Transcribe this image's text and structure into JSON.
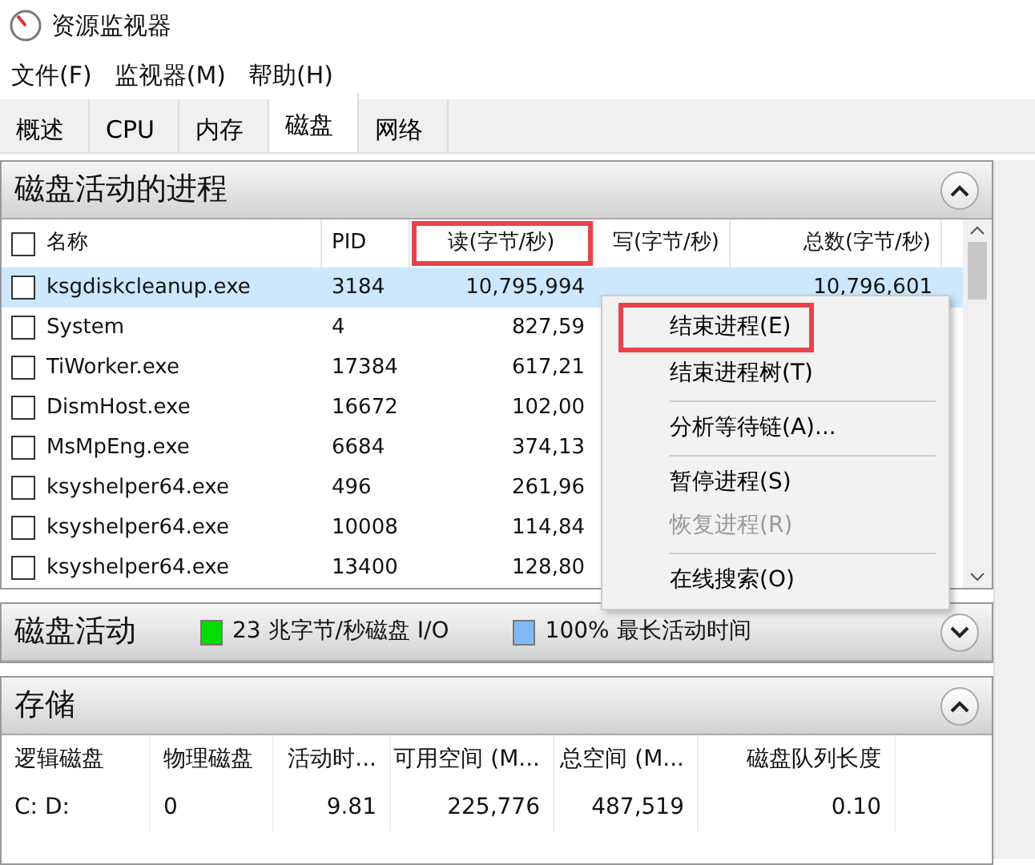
{
  "window": {
    "title": "资源监视器"
  },
  "menu": [
    "文件(F)",
    "监视器(M)",
    "帮助(H)"
  ],
  "tabs": [
    {
      "label": "概述",
      "selected": false
    },
    {
      "label": "CPU",
      "selected": false
    },
    {
      "label": "内存",
      "selected": false
    },
    {
      "label": "磁盘",
      "selected": true
    },
    {
      "label": "网络",
      "selected": false
    }
  ],
  "processes": {
    "title": "磁盘活动的进程",
    "expanded": true,
    "columns": [
      {
        "label": "名称",
        "highlighted": false
      },
      {
        "label": "PID",
        "highlighted": false
      },
      {
        "label": "读(字节/秒)",
        "highlighted": true
      },
      {
        "label": "写(字节/秒)",
        "highlighted": false
      },
      {
        "label": "总数(字节/秒)",
        "highlighted": false
      }
    ],
    "rows": [
      {
        "checked": false,
        "selected": true,
        "cells": [
          "ksgdiskcleanup.exe",
          "3184",
          "10,795,994",
          "",
          "10,796,601"
        ]
      },
      {
        "checked": false,
        "selected": false,
        "cells": [
          "System",
          "4",
          "827,59",
          "",
          ""
        ]
      },
      {
        "checked": false,
        "selected": false,
        "cells": [
          "TiWorker.exe",
          "17384",
          "617,21",
          "",
          ""
        ]
      },
      {
        "checked": false,
        "selected": false,
        "cells": [
          "DismHost.exe",
          "16672",
          "102,00",
          "",
          ""
        ]
      },
      {
        "checked": false,
        "selected": false,
        "cells": [
          "MsMpEng.exe",
          "6684",
          "374,13",
          "",
          ""
        ]
      },
      {
        "checked": false,
        "selected": false,
        "cells": [
          "ksyshelper64.exe",
          "496",
          "261,96",
          "",
          ""
        ]
      },
      {
        "checked": false,
        "selected": false,
        "cells": [
          "ksyshelper64.exe",
          "10008",
          "114,84",
          "",
          ""
        ]
      },
      {
        "checked": false,
        "selected": false,
        "cells": [
          "ksyshelper64.exe",
          "13400",
          "128,80",
          "",
          ""
        ]
      }
    ]
  },
  "context_menu": [
    {
      "label": "结束进程(E)",
      "disabled": false,
      "highlighted": true,
      "separator_before": false
    },
    {
      "label": "结束进程树(T)",
      "disabled": false,
      "highlighted": false,
      "separator_before": false
    },
    {
      "label": "分析等待链(A)...",
      "disabled": false,
      "highlighted": false,
      "separator_before": true
    },
    {
      "label": "暂停进程(S)",
      "disabled": false,
      "highlighted": false,
      "separator_before": true
    },
    {
      "label": "恢复进程(R)",
      "disabled": true,
      "highlighted": false,
      "separator_before": false
    },
    {
      "label": "在线搜索(O)",
      "disabled": false,
      "highlighted": false,
      "separator_before": true
    }
  ],
  "disk_activity": {
    "title": "磁盘活动",
    "expanded": false,
    "legend": [
      {
        "label": "23 兆字节/秒磁盘 I/O",
        "color": "#00dd00"
      },
      {
        "label": "100% 最长活动时间",
        "color": "#80b8f8"
      }
    ]
  },
  "storage": {
    "title": "存储",
    "expanded": true,
    "columns": [
      "逻辑磁盘",
      "物理磁盘",
      "活动时...",
      "可用空间 (M...",
      "总空间 (M...",
      "磁盘队列长度"
    ],
    "rows": [
      [
        "C: D:",
        "0",
        "9.81",
        "225,776",
        "487,519",
        "0.10"
      ]
    ]
  }
}
